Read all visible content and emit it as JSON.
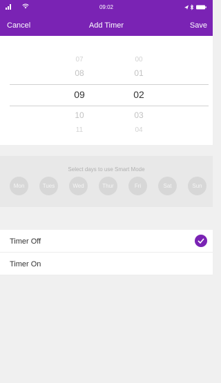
{
  "status_bar": {
    "time": "09:02"
  },
  "nav": {
    "cancel_label": "Cancel",
    "title": "Add Timer",
    "save_label": "Save"
  },
  "picker": {
    "hours": [
      "07",
      "08",
      "09",
      "10",
      "11"
    ],
    "minutes": [
      "00",
      "01",
      "02",
      "03",
      "04"
    ],
    "selected_hour": "09",
    "selected_minute": "02"
  },
  "smart_mode": {
    "label": "Select days to use Smart Mode",
    "days": [
      "Mon",
      "Tues",
      "Wed",
      "Thur",
      "Fri",
      "Sat",
      "Sun"
    ]
  },
  "options": [
    {
      "label": "Timer Off",
      "selected": true
    },
    {
      "label": "Timer On",
      "selected": false
    }
  ],
  "colors": {
    "accent": "#7a23b4",
    "background": "#f0f0f0"
  },
  "icons": [
    "signal-icon",
    "wifi-icon",
    "location-icon",
    "bluetooth-icon",
    "battery-icon",
    "checkmark-icon"
  ]
}
